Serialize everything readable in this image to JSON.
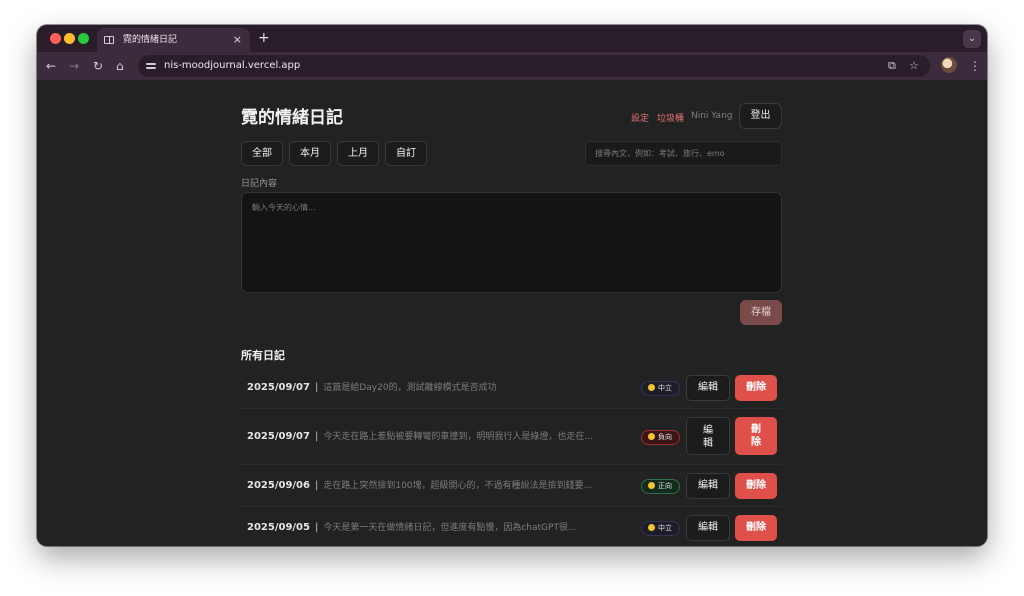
{
  "browser": {
    "tab_title": "霓的情緒日記",
    "tab_close": "×",
    "new_tab": "+",
    "url": "nis-moodjournal.vercel.app"
  },
  "header": {
    "title": "霓的情緒日記",
    "settings": "設定",
    "trash": "垃圾桶",
    "user": "Nini Yang",
    "logout": "登出"
  },
  "filters": {
    "all": "全部",
    "this_month": "本月",
    "last_month": "上月",
    "custom": "自訂"
  },
  "search": {
    "placeholder": "搜尋內文，例如：考試、旅行、emo"
  },
  "editor": {
    "label": "日記內容",
    "placeholder": "輸入今天的心情...",
    "save": "存檔"
  },
  "list": {
    "title": "所有日記",
    "separator": "|",
    "entries": [
      {
        "date": "2025/09/07",
        "preview": "這篇是給Day20的，測試離線模式是否成功",
        "mood": "中立",
        "edit": "編輯",
        "edit_line1": "",
        "edit_line2": "",
        "delete": "刪除",
        "delete_line1": "",
        "delete_line2": ""
      },
      {
        "date": "2025/09/07",
        "preview": "今天走在路上差點被要轉彎的車撞到，明明我行人是綠燈，也走在...",
        "mood": "負向",
        "edit": "",
        "edit_line1": "編",
        "edit_line2": "輯",
        "delete": "",
        "delete_line1": "刪",
        "delete_line2": "除"
      },
      {
        "date": "2025/09/06",
        "preview": "走在路上突然撿到100塊，超級開心的，不過有種說法是撿到錢要...",
        "mood": "正向",
        "edit": "編輯",
        "delete": "刪除"
      },
      {
        "date": "2025/09/05",
        "preview": "今天是第一天在做情緒日記，但進度有點慢，因為chatGPT很...",
        "mood": "中立",
        "edit": "編輯",
        "delete": "刪除"
      }
    ]
  },
  "colors": {
    "background": "#222222",
    "accent_red": "#e0504a",
    "link_red": "#e57373",
    "mood_negative_border": "#a03030",
    "mood_positive_border": "#2e6e48"
  }
}
